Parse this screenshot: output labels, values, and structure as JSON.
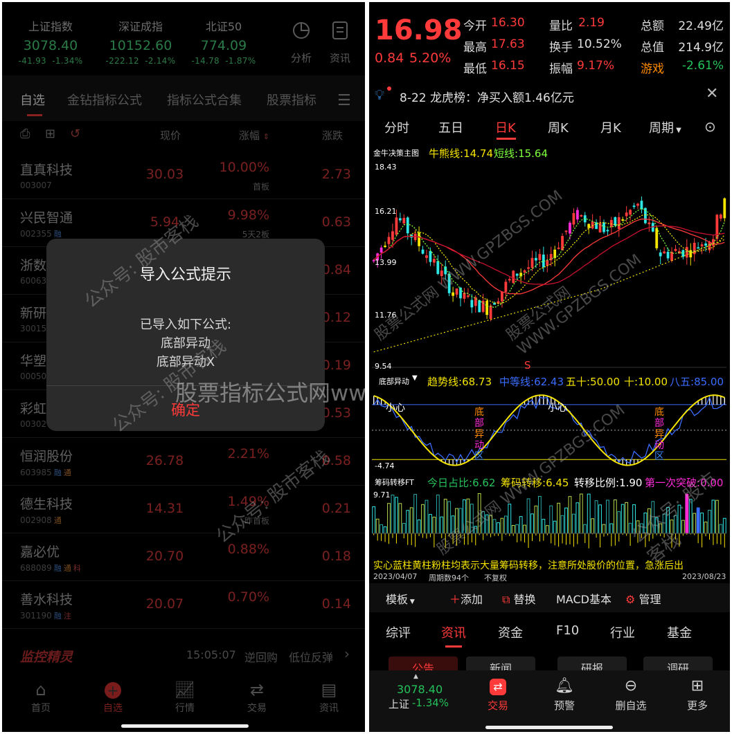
{
  "left": {
    "indices": [
      {
        "name": "上证指数",
        "value": "3078.40",
        "change": "-41.93",
        "pct": "-1.34%"
      },
      {
        "name": "深证成指",
        "value": "10152.60",
        "change": "-222.12",
        "pct": "-2.14%"
      },
      {
        "name": "北证50",
        "value": "774.09",
        "change": "-14.78",
        "pct": "-1.87%"
      }
    ],
    "top_actions": {
      "analysis": "分析",
      "news": "资讯"
    },
    "tabs": [
      "自选",
      "金钻指标公式",
      "指标公式合集",
      "股票指标"
    ],
    "columns": {
      "price": "现价",
      "pct": "涨幅",
      "chg": "涨跌"
    },
    "stocks": [
      {
        "name": "直真科技",
        "code": "003007",
        "price": "30.03",
        "pct": "10.00%",
        "tag": "首板",
        "chg": "2.73",
        "badges": []
      },
      {
        "name": "兴民智通",
        "code": "002355",
        "price": "5.94",
        "pct": "9.98%",
        "tag": "5天2板",
        "chg": "0.63",
        "badges": [
          "融"
        ]
      },
      {
        "name": "浙数",
        "code": "60063",
        "price": "",
        "pct": "",
        "tag": "",
        "chg": "0.84",
        "badges": []
      },
      {
        "name": "新研",
        "code": "30015",
        "price": "",
        "pct": "",
        "tag": "",
        "chg": "0.12",
        "badges": []
      },
      {
        "name": "华塑",
        "code": "00050",
        "price": "",
        "pct": "",
        "tag": "",
        "chg": "0.19",
        "badges": []
      },
      {
        "name": "彩虹",
        "code": "00302",
        "price": "",
        "pct": "",
        "tag": "",
        "chg": "0.53",
        "badges": []
      },
      {
        "name": "恒润股份",
        "code": "603985",
        "price": "26.78",
        "pct": "2.21%",
        "tag": "",
        "chg": "0.58",
        "badges": [
          "融",
          "通"
        ]
      },
      {
        "name": "德生科技",
        "code": "002908",
        "price": "14.31",
        "pct": "1.49%",
        "tag": "昨首板",
        "chg": "0.21",
        "badges": [
          "通"
        ]
      },
      {
        "name": "嘉必优",
        "code": "688089",
        "price": "20.70",
        "pct": "0.88%",
        "tag": "",
        "chg": "0.18",
        "badges": [
          "融",
          "通",
          "科"
        ]
      },
      {
        "name": "善水科技",
        "code": "301190",
        "price": "20.07",
        "pct": "0.70%",
        "tag": "",
        "chg": "0.14",
        "badges": [
          "融",
          "注"
        ]
      }
    ],
    "monitor": {
      "title": "监控精灵",
      "time": "15:05:07",
      "event": "逆回购",
      "signal": "低位反弹"
    },
    "modal": {
      "title": "导入公式提示",
      "line1": "已导入如下公式:",
      "line2": "底部异动",
      "line3": "底部异动X",
      "confirm": "确定"
    },
    "nav": [
      "首页",
      "自选",
      "行情",
      "交易",
      "资讯"
    ],
    "watermark_big": "股票指标公式网www.gpzbgs.com",
    "watermark_a": "公众号: 股市客栈",
    "watermark_b": "股票公式网 WWW.GPZBGS.COM"
  },
  "right": {
    "price": "16.98",
    "change": "0.84",
    "pct": "5.20%",
    "grid": [
      [
        "今开",
        "16.30",
        "量比",
        "2.19",
        "总额",
        "22.49亿"
      ],
      [
        "最高",
        "17.63",
        "换手",
        "10.52%",
        "总值",
        "214.9亿"
      ],
      [
        "最低",
        "16.15",
        "振幅",
        "9.17%",
        "游戏",
        "-2.61%"
      ]
    ],
    "notice": "8-22 龙虎榜：净买入额1.46亿元",
    "ktabs": [
      "分时",
      "五日",
      "日K",
      "周K",
      "月K",
      "周期"
    ],
    "main_indicator": {
      "name": "金牛决策主图",
      "l1": "牛熊线:",
      "v1": "14.74",
      "l2": "短线:",
      "v2": "15.64"
    },
    "main_ticks": [
      "18.43",
      "16.21",
      "13.99",
      "11.76",
      "9.54"
    ],
    "sub1": {
      "name": "底部异动",
      "items": [
        [
          "趋势线:",
          "68.73"
        ],
        [
          "中等线:",
          "62.43"
        ],
        [
          "五十:",
          "50.00"
        ],
        [
          "十:",
          "10.00"
        ],
        [
          "八五:",
          "85.00"
        ]
      ],
      "low": "-4.74",
      "caution": "小心",
      "zone": [
        "底",
        "部",
        "异",
        "动",
        "区"
      ]
    },
    "sub2": {
      "name": "筹码转移FT",
      "items": [
        [
          "今日占比:",
          "6.62"
        ],
        [
          "筹码转移:",
          "6.45"
        ],
        [
          "转移比例:",
          "1.90"
        ],
        [
          "第一次突破:",
          "0.00"
        ]
      ],
      "top": "9.71"
    },
    "sub2_note": "实心蓝柱黄柱粉柱均表示大量筹码转移，注意所处股价的位置，急涨后出",
    "date_bar": {
      "start": "2023/04/07",
      "count": "周期数94个",
      "adj": "不复权",
      "end": "2023/08/23"
    },
    "toolbar": [
      "模板",
      "添加",
      "替换",
      "MACD基本",
      "管理"
    ],
    "btabs": [
      "综评",
      "资讯",
      "资金",
      "F10",
      "行业",
      "基金"
    ],
    "subtabs": [
      "公告",
      "新闻",
      "研报",
      "调研"
    ],
    "footer": {
      "index_value": "3078.40",
      "index_name": "上证",
      "index_pct": "-1.34%",
      "nav": [
        "交易",
        "预警",
        "删自选",
        "更多"
      ]
    },
    "s_marker": "S",
    "chart_data": {
      "type": "candlestick",
      "title": "金牛决策主图",
      "ylim": [
        9.54,
        18.43
      ],
      "x_range": [
        "2023/04/07",
        "2023/08/23"
      ],
      "bars": 94,
      "lines": [
        {
          "name": "牛熊线",
          "last": 14.74
        },
        {
          "name": "短线",
          "last": 15.64
        }
      ]
    }
  }
}
